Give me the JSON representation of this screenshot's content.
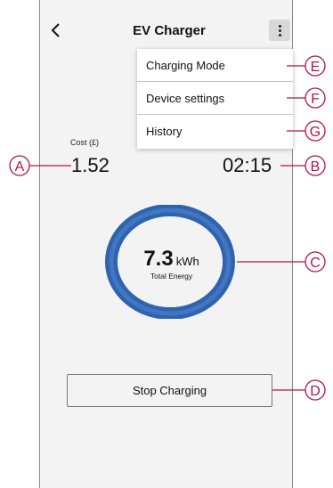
{
  "header": {
    "title": "EV Charger",
    "back_icon": "chevron-left-icon",
    "menu_icon": "kebab-menu-icon"
  },
  "menu": {
    "items": [
      {
        "label": "Charging Mode"
      },
      {
        "label": "Device settings"
      },
      {
        "label": "History"
      }
    ]
  },
  "stats": {
    "cost_label": "Cost (£)",
    "cost_value": "1.52",
    "time_value": "02:15"
  },
  "energy": {
    "value": "7.3",
    "unit": "kWh",
    "label": "Total Energy"
  },
  "actions": {
    "stop_label": "Stop Charging"
  },
  "callouts": {
    "a": "A",
    "b": "B",
    "c": "C",
    "d": "D",
    "e": "E",
    "f": "F",
    "g": "G"
  },
  "colors": {
    "ring": "#3c73bd",
    "callout": "#b0144b",
    "background": "#f3f3f3"
  }
}
